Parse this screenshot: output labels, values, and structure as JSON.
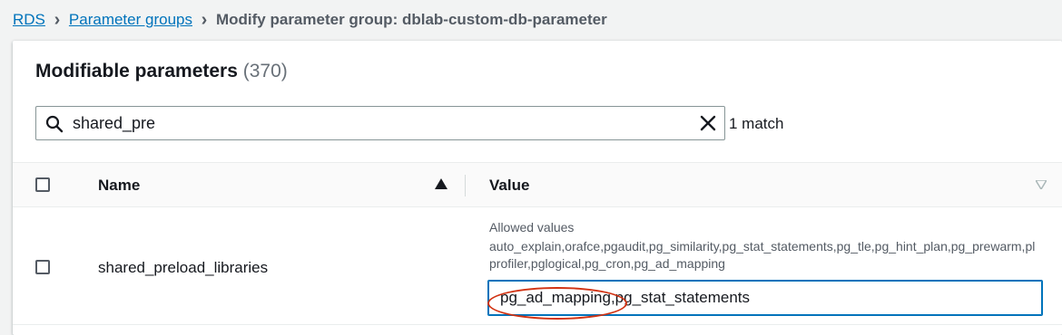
{
  "breadcrumb": {
    "rds": "RDS",
    "parameter_groups": "Parameter groups",
    "separator": ">",
    "current": "Modify parameter group: dblab-custom-db-parameter"
  },
  "panel": {
    "title": "Modifiable parameters",
    "count": "(370)"
  },
  "search": {
    "value": "shared_pre",
    "match_text": "1 match",
    "icon": "search-icon",
    "clear_icon": "close-icon"
  },
  "table": {
    "columns": {
      "name": "Name",
      "value": "Value"
    },
    "sort": {
      "column": "Name",
      "direction": "ascending"
    },
    "rows": [
      {
        "name": "shared_preload_libraries",
        "allowed_label": "Allowed values",
        "allowed_values": "auto_explain,orafce,pgaudit,pg_similarity,pg_stat_statements,pg_tle,pg_hint_plan,pg_prewarm,plprofiler,pglogical,pg_cron,pg_ad_mapping",
        "value": "pg_ad_mapping,pg_stat_statements",
        "selected": false
      }
    ]
  },
  "colors": {
    "link": "#0073bb",
    "annotation": "#d13212",
    "input_focus": "#0073bb"
  }
}
